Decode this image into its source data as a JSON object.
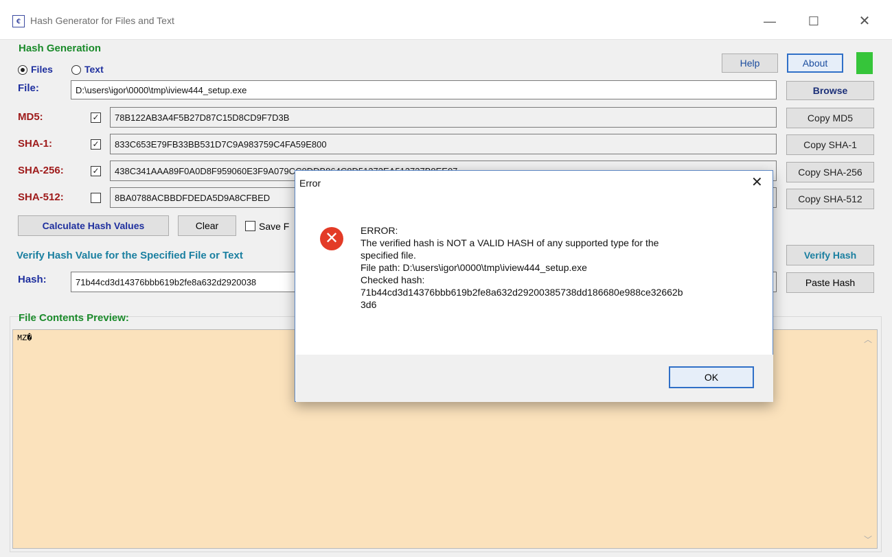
{
  "window": {
    "icon_glyph": "¢",
    "title": "Hash Generator for Files and Text",
    "controls": {
      "minimize": "—",
      "maximize": "☐",
      "close": "✕"
    }
  },
  "hash_generation": {
    "group_label": "Hash Generation",
    "mode": {
      "files_label": "Files",
      "text_label": "Text",
      "selected": "Files"
    },
    "help_label": "Help",
    "about_label": "About",
    "status_color": "#36c53a",
    "file_label": "File:",
    "file_path": "D:\\users\\igor\\0000\\tmp\\iview444_setup.exe",
    "browse_label": "Browse",
    "hashes": [
      {
        "label": "MD5:",
        "checked": true,
        "value": "78B122AB3A4F5B27D87C15D8CD9F7D3B",
        "copy_label": "Copy MD5"
      },
      {
        "label": "SHA-1:",
        "checked": true,
        "value": "833C653E79FB33BB531D7C9A983759C4FA59E800",
        "copy_label": "Copy SHA-1"
      },
      {
        "label": "SHA-256:",
        "checked": true,
        "value": "438C341AAA89F0A0D8F959060E3F9A079CC0DDB864C8D51272EA512737B8EE07",
        "copy_label": "Copy SHA-256"
      },
      {
        "label": "SHA-512:",
        "checked": false,
        "value": "8BA0788ACBBDFDEDA5D9A8CFBED",
        "copy_label": "Copy SHA-512"
      }
    ],
    "calc_label": "Calculate Hash Values",
    "clear_label": "Clear",
    "save_label": "Save F"
  },
  "verify": {
    "group_label": "Verify Hash Value for the Specified File or Text",
    "hash_label": "Hash:",
    "hash_value": "71b44cd3d14376bbb619b2fe8a632d2920038",
    "verify_label": "Verify Hash",
    "paste_label": "Paste Hash"
  },
  "preview": {
    "group_label": "File Contents Preview:",
    "content": "MZ�"
  },
  "dialog": {
    "title": "Error",
    "close_glyph": "✕",
    "icon_glyph": "✕",
    "message_lines": [
      "ERROR:",
      "The verified hash is NOT a VALID HASH of any supported type for the",
      "specified file.",
      "File path: D:\\users\\igor\\0000\\tmp\\iview444_setup.exe",
      "Checked hash:",
      "71b44cd3d14376bbb619b2fe8a632d29200385738dd186680e988ce32662b",
      "3d6"
    ],
    "ok_label": "OK"
  },
  "icons": {
    "app": "app-logo-icon",
    "error": "error-icon",
    "scroll_up": "scroll-up-icon",
    "scroll_down": "scroll-down-icon"
  }
}
